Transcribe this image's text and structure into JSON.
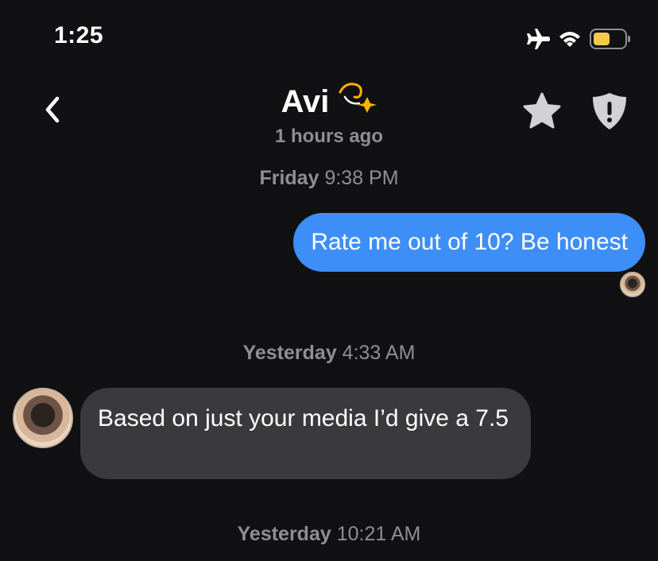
{
  "status_bar": {
    "time": "1:25",
    "icons": [
      "airplane-icon",
      "wifi-icon",
      "battery-icon"
    ],
    "battery_color": "#f2c94c"
  },
  "header": {
    "name": "Avi",
    "name_emoji": "💫",
    "last_seen": "1 hours ago",
    "icons": [
      "chevron-left-icon",
      "star-icon",
      "shield-alert-icon"
    ],
    "icon_color": "#d1d1d6"
  },
  "conversation": {
    "timestamps": [
      {
        "day": "Friday",
        "time": "9:38 PM"
      },
      {
        "day": "Yesterday",
        "time": "4:33 AM"
      },
      {
        "day": "Yesterday",
        "time": "10:21 AM"
      }
    ],
    "messages": [
      {
        "direction": "sent",
        "text": "Rate me out of 10? Be honest",
        "color": "#3e8ef7"
      },
      {
        "direction": "received",
        "text": "Based on just your media I’d give a 7.5",
        "color": "#3a3a3c"
      }
    ]
  }
}
